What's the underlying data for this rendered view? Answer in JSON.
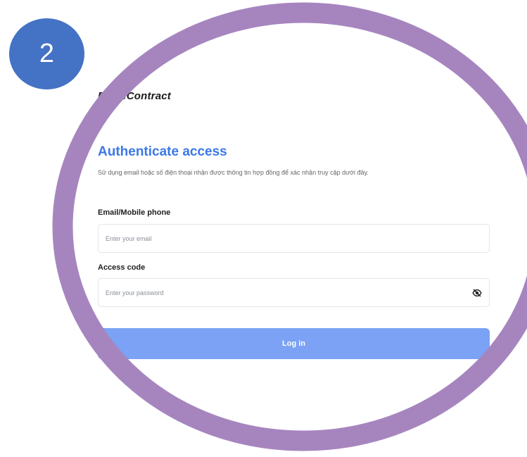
{
  "step": {
    "number": "2",
    "badge_color": "#4472c4",
    "ring_color": "#a685bf"
  },
  "brand": {
    "name": "FPT.eContract"
  },
  "auth": {
    "title": "Authenticate access",
    "subtitle": "Sử dụng email hoặc số điện thoại nhận được thông tin hợp đồng để xác nhận truy cập dưới đây.",
    "email": {
      "label": "Email/Mobile phone",
      "value": "",
      "placeholder": "Enter your email"
    },
    "access_code": {
      "label": "Access code",
      "value": "",
      "placeholder": "Enter your password",
      "toggle_icon": "eye-off-icon"
    },
    "login_label": "Log in",
    "accent_color": "#3b78e7",
    "button_color": "#7ba2f4"
  }
}
